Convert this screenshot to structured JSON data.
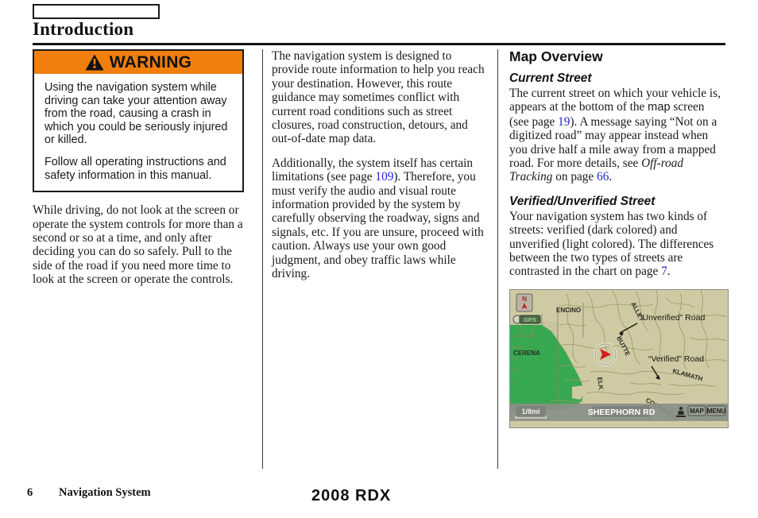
{
  "header": {
    "tab_label": "",
    "title": "Introduction"
  },
  "warning": {
    "icon": "warning-triangle-icon",
    "label": "WARNING",
    "accent_color": "#f07f0e",
    "paragraphs": [
      "Using the navigation system while driving can take your attention away from the road, causing a crash in which you could be seriously injured or killed.",
      "Follow all operating instructions and safety information in this manual."
    ]
  },
  "column1": {
    "paragraph": "While driving, do not look at the screen or operate the system controls for more than a second or so at a time, and only after deciding you can do so safely. Pull to the side of the road if you need more time to look at the screen or operate the controls."
  },
  "column2": {
    "paragraph1": "The navigation system is designed to provide route information to help you reach your destination. However, this route guidance may sometimes conflict with current road conditions such as street closures, road construction, detours, and out-of-date map data.",
    "paragraph2_a": "Additionally, the system itself has certain limitations (see page ",
    "paragraph2_ref": "109",
    "paragraph2_b": "). Therefore, you must verify the audio and visual route information provided by the system by carefully observing the roadway, signs and signals, etc. If you are unsure, proceed with caution. Always use your own good judgment, and obey traffic laws while driving."
  },
  "column3": {
    "section_title": "Map Overview",
    "sub1_title": "Current Street",
    "sub1_a": "The current street on which your vehicle is, appears at the bottom of the ",
    "sub1_map_word": "map",
    "sub1_b": " screen (see page ",
    "sub1_ref1": "19",
    "sub1_c": "). A message saying “Not on a digitized road” may appear instead when you drive half a mile away from a mapped road. For more details, see ",
    "sub1_italic": "Off-road Tracking",
    "sub1_d": " on page ",
    "sub1_ref2": "66",
    "sub1_e": ".",
    "sub2_title": "Verified/Unverified Street",
    "sub2_a": "Your navigation system has two kinds of streets: verified (dark colored) and unverified (light colored). The differences between the two types of streets are contrasted in the chart on page ",
    "sub2_ref": "7",
    "sub2_b": "."
  },
  "nav_screenshot": {
    "compass_icon": "north-arrow-icon",
    "compass_letter": "N",
    "gps_badge": "GPS",
    "scale_label": "1/8mi",
    "current_street": "SHEEPHORN RD",
    "map_button": "MAP",
    "menu_button": "MENU",
    "person_icon": "pedestrian-icon",
    "vehicle_icon": "vehicle-position-icon",
    "street_labels": [
      "ENCINO",
      "CERENA",
      "ALLEY",
      "BUTTE",
      "ELK",
      "KLAMATH",
      "COLORADO"
    ],
    "callouts": [
      "“Unverified” Road",
      "“Verified” Road"
    ],
    "colors": {
      "map_background": "#cfcaa3",
      "park_green": "#3cae54",
      "road_line": "#8f8f5a",
      "status_bar": "#8b9089",
      "vehicle_marker": "#d81d20"
    }
  },
  "footer": {
    "page_number": "6",
    "section_label": "Navigation System",
    "model": "2008  RDX"
  }
}
